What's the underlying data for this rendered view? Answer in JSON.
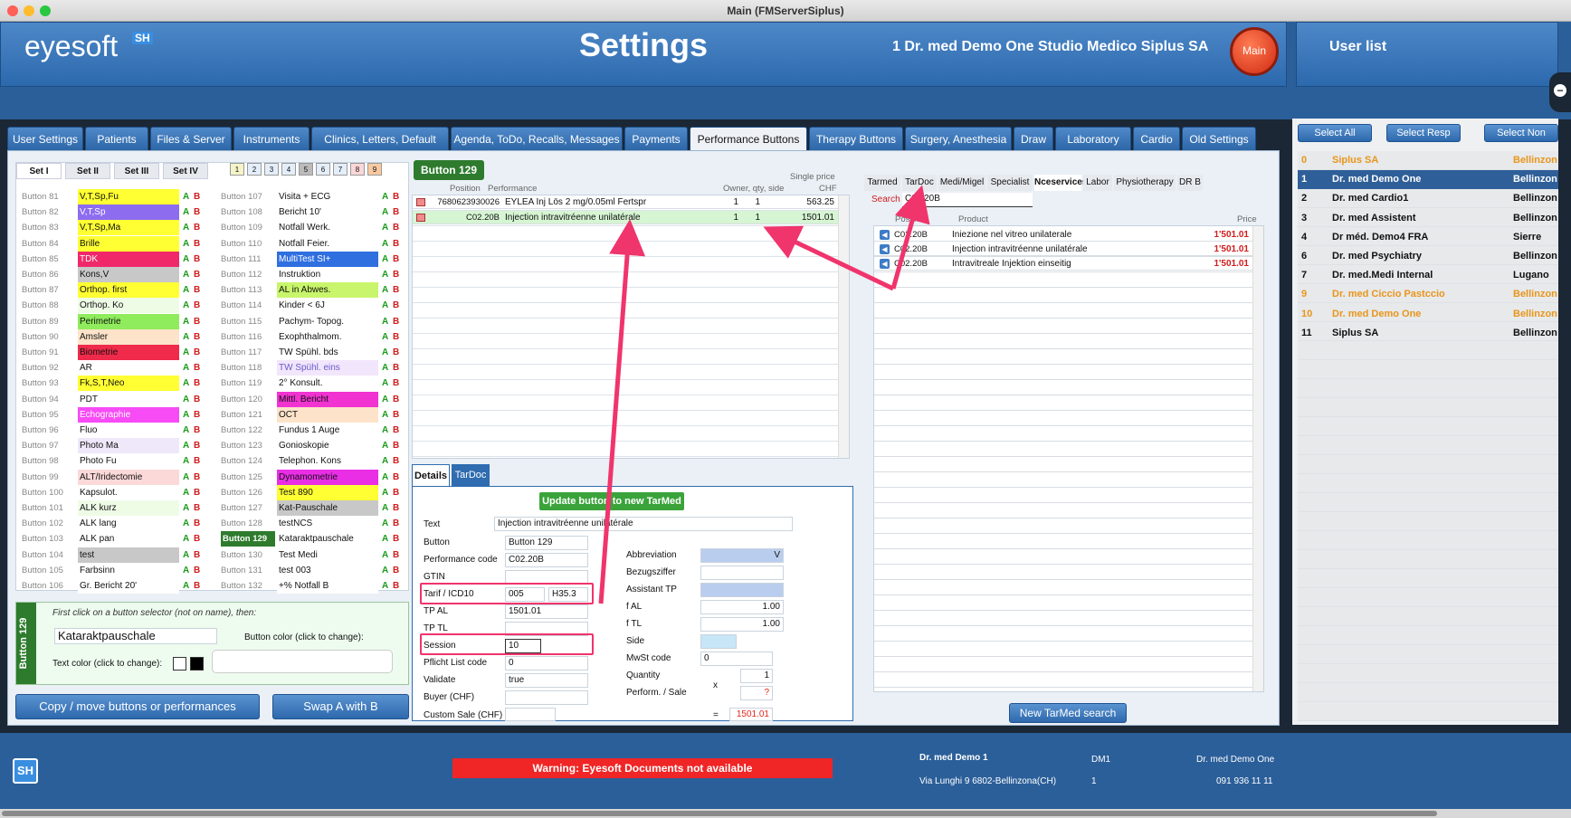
{
  "window": {
    "title": "Main (FMServerSiplus)"
  },
  "header": {
    "logo": "eyesoft",
    "logo_badge": "SH",
    "page_title": "Settings",
    "doctor_info": "1 Dr. med Demo One  Studio Medico Siplus SA",
    "main_button": "Main",
    "userlist_title": "User list"
  },
  "tabs": [
    "User Settings",
    "Patients",
    "Files & Server",
    "Instruments",
    "Clinics, Letters, Default texts",
    "Agenda, ToDo, Recalls, Messages",
    "Payments",
    "Performance Buttons",
    "Therapy Buttons",
    "Surgery, Anesthesia",
    "Draw",
    "Laboratory",
    "Cardio",
    "Old Settings"
  ],
  "sets": [
    "Set I",
    "Set II",
    "Set III",
    "Set IV"
  ],
  "set_numbers": [
    "1",
    "2",
    "3",
    "4",
    "5",
    "6",
    "7",
    "8",
    "9"
  ],
  "buttons_col1": [
    {
      "name": "Button 81",
      "label": "V,T,Sp,Fu",
      "bg": "#ffff33",
      "fg": "#111"
    },
    {
      "name": "Button 82",
      "label": "V,T,Sp",
      "bg": "#8d6cf0",
      "fg": "#fff"
    },
    {
      "name": "Button 83",
      "label": "V,T,Sp,Ma",
      "bg": "#ffff33",
      "fg": "#111"
    },
    {
      "name": "Button 84",
      "label": "Brille",
      "bg": "#ffff33",
      "fg": "#111"
    },
    {
      "name": "Button 85",
      "label": "TDK",
      "bg": "#f0286a",
      "fg": "#fff"
    },
    {
      "name": "Button 86",
      "label": "Kons,V",
      "bg": "#c8c8c8",
      "fg": "#111"
    },
    {
      "name": "Button 87",
      "label": "Orthop. first",
      "bg": "#ffff33",
      "fg": "#111"
    },
    {
      "name": "Button 88",
      "label": "Orthop. Ko",
      "bg": "#eefce6",
      "fg": "#111"
    },
    {
      "name": "Button 89",
      "label": "Perimetrie",
      "bg": "#8fec5c",
      "fg": "#111"
    },
    {
      "name": "Button 90",
      "label": "Amsler",
      "bg": "#fde3c9",
      "fg": "#111"
    },
    {
      "name": "Button 91",
      "label": "Biometrie",
      "bg": "#ef2a4a",
      "fg": "#111"
    },
    {
      "name": "Button 92",
      "label": "AR",
      "bg": "#ffffff",
      "fg": "#111"
    },
    {
      "name": "Button 93",
      "label": "Fk,S,T,Neo",
      "bg": "#ffff33",
      "fg": "#111"
    },
    {
      "name": "Button 94",
      "label": "PDT",
      "bg": "#ffffff",
      "fg": "#111"
    },
    {
      "name": "Button 95",
      "label": "Echographie",
      "bg": "#f74bf6",
      "fg": "#fff"
    },
    {
      "name": "Button 96",
      "label": "Fluo",
      "bg": "#ffffff",
      "fg": "#111"
    },
    {
      "name": "Button 97",
      "label": "Photo Ma",
      "bg": "#efe8fb",
      "fg": "#111"
    },
    {
      "name": "Button 98",
      "label": "Photo Fu",
      "bg": "#ffffff",
      "fg": "#111"
    },
    {
      "name": "Button 99",
      "label": "ALT/Iridectomie",
      "bg": "#fbd9d9",
      "fg": "#111"
    },
    {
      "name": "Button 100",
      "label": "Kapsulot.",
      "bg": "#ffffff",
      "fg": "#111"
    },
    {
      "name": "Button 101",
      "label": "ALK kurz",
      "bg": "#eefce6",
      "fg": "#111"
    },
    {
      "name": "Button 102",
      "label": "ALK lang",
      "bg": "#ffffff",
      "fg": "#111"
    },
    {
      "name": "Button 103",
      "label": "ALK pan",
      "bg": "#ffffff",
      "fg": "#111"
    },
    {
      "name": "Button 104",
      "label": "test",
      "bg": "#c8c8c8",
      "fg": "#111"
    },
    {
      "name": "Button 105",
      "label": "Farbsinn",
      "bg": "#ffffff",
      "fg": "#111"
    },
    {
      "name": "Button 106",
      "label": "Gr. Bericht 20'",
      "bg": "#ffffff",
      "fg": "#111"
    }
  ],
  "buttons_col2": [
    {
      "name": "Button 107",
      "label": "Visita + ECG",
      "bg": "#ffffff",
      "fg": "#111"
    },
    {
      "name": "Button 108",
      "label": "Bericht 10'",
      "bg": "#ffffff",
      "fg": "#111"
    },
    {
      "name": "Button 109",
      "label": "Notfall Werk.",
      "bg": "#ffffff",
      "fg": "#111"
    },
    {
      "name": "Button 110",
      "label": "Notfall Feier.",
      "bg": "#ffffff",
      "fg": "#111"
    },
    {
      "name": "Button 111",
      "label": "MultiTest SI+",
      "bg": "#2f6fe0",
      "fg": "#fff"
    },
    {
      "name": "Button 112",
      "label": "Instruktion",
      "bg": "#ffffff",
      "fg": "#111"
    },
    {
      "name": "Button 113",
      "label": "AL in Abwes.",
      "bg": "#c8f56b",
      "fg": "#111"
    },
    {
      "name": "Button 114",
      "label": "Kinder < 6J",
      "bg": "#ffffff",
      "fg": "#111"
    },
    {
      "name": "Button 115",
      "label": "Pachym- Topog.",
      "bg": "#ffffff",
      "fg": "#111"
    },
    {
      "name": "Button 116",
      "label": "Exophthalmom.",
      "bg": "#ffffff",
      "fg": "#111"
    },
    {
      "name": "Button 117",
      "label": "TW Spühl. bds",
      "bg": "#ffffff",
      "fg": "#111"
    },
    {
      "name": "Button 118",
      "label": "TW Spühl. eins",
      "bg": "#f1e6fb",
      "fg": "#6a5acd"
    },
    {
      "name": "Button 119",
      "label": "2° Konsult.",
      "bg": "#ffffff",
      "fg": "#111"
    },
    {
      "name": "Button 120",
      "label": "Mittl. Bericht",
      "bg": "#f133d1",
      "fg": "#111"
    },
    {
      "name": "Button 121",
      "label": "OCT",
      "bg": "#fde3c9",
      "fg": "#111"
    },
    {
      "name": "Button 122",
      "label": "Fundus 1 Auge",
      "bg": "#ffffff",
      "fg": "#111"
    },
    {
      "name": "Button 123",
      "label": "Gonioskopie",
      "bg": "#ffffff",
      "fg": "#111"
    },
    {
      "name": "Button 124",
      "label": "Telephon. Kons",
      "bg": "#ffffff",
      "fg": "#111"
    },
    {
      "name": "Button 125",
      "label": "Dynamometrie",
      "bg": "#e92ee6",
      "fg": "#111"
    },
    {
      "name": "Button 126",
      "label": "Test 890",
      "bg": "#ffff33",
      "fg": "#111"
    },
    {
      "name": "Button 127",
      "label": "Kat-Pauschale",
      "bg": "#c8c8c8",
      "fg": "#111"
    },
    {
      "name": "Button 128",
      "label": "testNCS",
      "bg": "#ffffff",
      "fg": "#111"
    },
    {
      "name": "Button 129",
      "label": "Kataraktpauschale",
      "bg": "#ffffff",
      "fg": "#111"
    },
    {
      "name": "Button 130",
      "label": "Test Medi",
      "bg": "#ffffff",
      "fg": "#111"
    },
    {
      "name": "Button 131",
      "label": "test 003",
      "bg": "#ffffff",
      "fg": "#111"
    },
    {
      "name": "Button 132",
      "label": "+% Notfall B",
      "bg": "#ffffff",
      "fg": "#111"
    }
  ],
  "ab": {
    "a": "A",
    "b": "B"
  },
  "selected_button": {
    "name": "Button 129",
    "instruction": "First click on a button selector (not on name), then:",
    "name_value": "Kataraktpauschale",
    "button_color_label": "Button color (click to change):",
    "text_color_label": "Text color (click to change):"
  },
  "bottom_buttons": {
    "copy": "Copy / move buttons or performances",
    "swap": "Swap A with B"
  },
  "perf_table": {
    "title": "Button 129",
    "headers": {
      "position": "Position",
      "performance": "Performance",
      "owner": "Owner, qty, side",
      "single": "Single price",
      "chf": "CHF"
    },
    "rows": [
      {
        "position": "7680623930026",
        "performance": "EYLEA Inj Lös 2 mg/0.05ml Fertspr",
        "owner": "1",
        "qty": "1",
        "price": "563.25"
      },
      {
        "position": "C02.20B",
        "performance": "Injection intravitréenne unilatérale",
        "owner": "1",
        "qty": "1",
        "price": "1501.01"
      }
    ]
  },
  "details": {
    "tabs": [
      "Details",
      "TarDoc"
    ],
    "update_btn": "Update button to new TarMed",
    "text_label": "Text",
    "text_value": "Injection intravitréenne unilatérale",
    "button_label": "Button",
    "button_value": "Button 129",
    "perfcode_label": "Performance code",
    "perfcode_value": "C02.20B",
    "gtin_label": "GTIN",
    "gtin_value": "",
    "tarif_label": "Tarif / ICD10",
    "tarif_value": "005",
    "icd_value": "H35.3",
    "tpal_label": "TP AL",
    "tpal_value": "1501.01",
    "tptl_label": "TP TL",
    "tptl_value": "",
    "session_label": "Session",
    "session_value": "10",
    "pflicht_label": "Pflicht List code",
    "pflicht_value": "0",
    "validate_label": "Validate",
    "validate_value": "true",
    "buyer_label": "Buyer (CHF)",
    "buyer_value": "",
    "custom_label": "Custom Sale (CHF)",
    "custom_value": "",
    "equals": "=",
    "total": "1501.01",
    "abbr_label": "Abbreviation",
    "abbr_value": "V",
    "bezug_label": "Bezugsziffer",
    "bezug_value": "",
    "assistant_label": "Assistant TP",
    "assistant_value": "",
    "fal_label": "f AL",
    "fal_value": "1.00",
    "ftl_label": "f TL",
    "ftl_value": "1.00",
    "side_label": "Side",
    "side_value": "",
    "mwst_label": "MwSt code",
    "mwst_value": "0",
    "qty_label": "Quantity",
    "qty_value": "1",
    "perform_label": "Perform. / Sale",
    "perform_value": "?",
    "x": "x"
  },
  "tardoc": {
    "tabs": [
      "Tarmed",
      "TarDoc",
      "Medi/Migel",
      "Specialist",
      "Nceservices",
      "Labor",
      "Physiotherapy",
      "DR B"
    ],
    "active_tab": "Nceservices",
    "search_label": "Search",
    "search_value": "C02.20B",
    "headers": {
      "position": "Position",
      "product": "Product",
      "price": "Price"
    },
    "rows": [
      {
        "position": "C02.20B",
        "product": "Iniezione nel vitreo unilaterale",
        "price": "1'501.01"
      },
      {
        "position": "C02.20B",
        "product": "Injection intravitréenne unilatérale",
        "price": "1'501.01"
      },
      {
        "position": "C02.20B",
        "product": "Intravitreale Injektion einseitig",
        "price": "1'501.01"
      }
    ],
    "new_search": "New TarMed search"
  },
  "sidebar": {
    "buttons": [
      "Select All",
      "Select Resp",
      "Select Non"
    ],
    "users": [
      {
        "id": "0",
        "name": "Siplus SA",
        "city": "Bellinzon",
        "color": "#e8961a",
        "selected": false
      },
      {
        "id": "1",
        "name": "Dr. med Demo One",
        "city": "Bellinzon",
        "color": "#ffffff",
        "selected": true
      },
      {
        "id": "2",
        "name": "Dr. med Cardio1",
        "city": "Bellinzon",
        "color": "#111111",
        "selected": false
      },
      {
        "id": "3",
        "name": "Dr. med Assistent",
        "city": "Bellinzon",
        "color": "#111111",
        "selected": false
      },
      {
        "id": "4",
        "name": "Dr méd. Demo4 FRA",
        "city": "Sierre",
        "color": "#111111",
        "selected": false
      },
      {
        "id": "6",
        "name": "Dr. med Psychiatry",
        "city": "Bellinzon",
        "color": "#111111",
        "selected": false
      },
      {
        "id": "7",
        "name": "Dr. med.Medi Internal",
        "city": "Lugano",
        "color": "#111111",
        "selected": false
      },
      {
        "id": "9",
        "name": "Dr. med Ciccio Pastccio",
        "city": "Bellinzon",
        "color": "#e8961a",
        "selected": false
      },
      {
        "id": "10",
        "name": "Dr. med Demo One",
        "city": "Bellinzon",
        "color": "#e8961a",
        "selected": false
      },
      {
        "id": "11",
        "name": "Siplus SA",
        "city": "Bellinzon",
        "color": "#111111",
        "selected": false
      }
    ]
  },
  "footer": {
    "logo": "SH",
    "warning": "Warning: Eyesoft Documents not available",
    "doctor": "Dr. med Demo 1",
    "address": "Via Lunghi 9 6802-Bellinzona(CH)",
    "code": "DM1",
    "code_num": "1",
    "doctor2": "Dr. med Demo One",
    "phone": "091 936 11 11"
  },
  "colors": {
    "accent": "#2b5f99",
    "highlight": "#f0346c",
    "green": "#2e7b2e"
  }
}
